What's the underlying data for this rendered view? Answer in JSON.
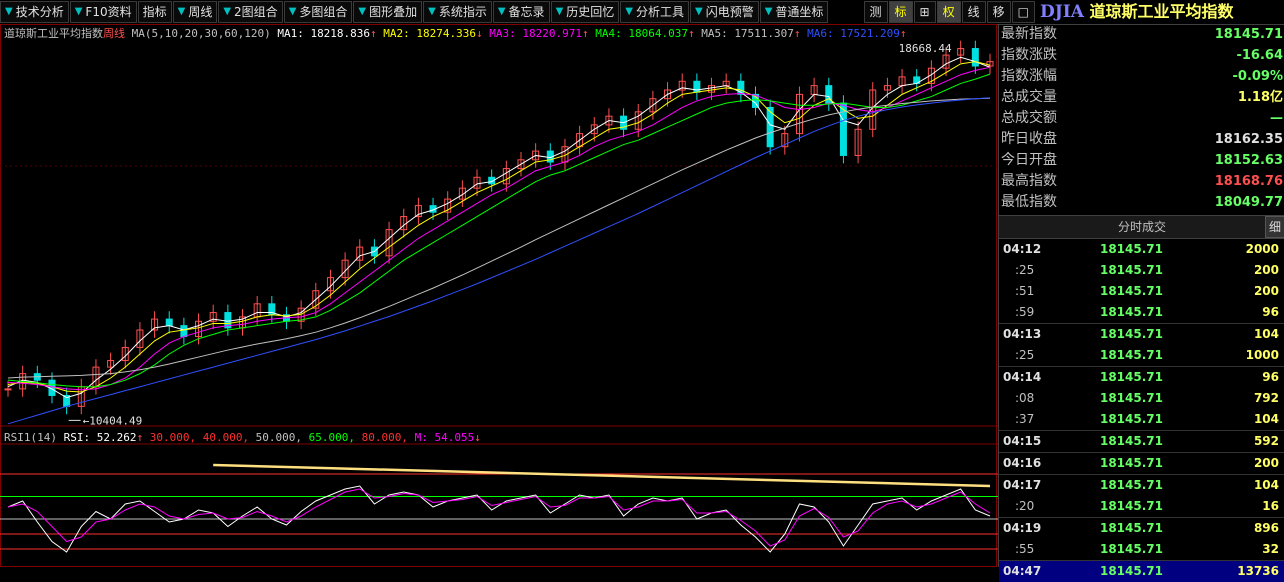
{
  "toolbar": {
    "items": [
      {
        "label": "技术分析",
        "arrow": true
      },
      {
        "label": "F10资料",
        "arrow": true
      },
      {
        "label": "指标",
        "arrow": false
      },
      {
        "label": "周线",
        "arrow": true
      },
      {
        "label": "2图组合",
        "arrow": true
      },
      {
        "label": "多图组合",
        "arrow": true
      },
      {
        "label": "图形叠加",
        "arrow": true
      },
      {
        "label": "系统指示",
        "arrow": true
      },
      {
        "label": "备忘录",
        "arrow": true
      },
      {
        "label": "历史回忆",
        "arrow": true
      },
      {
        "label": "分析工具",
        "arrow": true
      },
      {
        "label": "闪电预警",
        "arrow": true
      },
      {
        "label": "普通坐标",
        "arrow": true
      }
    ],
    "small": [
      "测",
      "标",
      "⊞",
      "权",
      "线",
      "移",
      "□"
    ]
  },
  "header": {
    "symbol": "DJIA",
    "name": "道琼斯工业平均指数"
  },
  "ma_legend": {
    "title": "道琼斯工业平均指数",
    "period": "周线",
    "params": "MA(5,10,20,30,60,120)",
    "items": [
      {
        "label": "MA1: 18218.836",
        "arrow": "↑",
        "color": "#ffffff"
      },
      {
        "label": "MA2: 18274.336",
        "arrow": "↓",
        "color": "#ffff00"
      },
      {
        "label": "MA3: 18220.971",
        "arrow": "↑",
        "color": "#ff00ff"
      },
      {
        "label": "MA4: 18064.037",
        "arrow": "↑",
        "color": "#00ff00"
      },
      {
        "label": "MA5: 17511.307",
        "arrow": "↑",
        "color": "#c0c0c0"
      },
      {
        "label": "MA6: 17521.209",
        "arrow": "↑",
        "color": "#3050ff"
      }
    ]
  },
  "rsi_legend": {
    "title": "RSI1(14)",
    "items": [
      {
        "label": "RSI: 52.262",
        "arrow": "↑",
        "color": "#ffffff"
      },
      {
        "label": "30.000,",
        "arrow": "",
        "color": "#ff3030"
      },
      {
        "label": "40.000,",
        "arrow": "",
        "color": "#ff3030"
      },
      {
        "label": "50.000,",
        "arrow": "",
        "color": "#c0c0c0"
      },
      {
        "label": "65.000,",
        "arrow": "",
        "color": "#00ff00"
      },
      {
        "label": "80.000,",
        "arrow": "",
        "color": "#ff3030"
      },
      {
        "label": "M: 54.055",
        "arrow": "↓",
        "color": "#ff00ff"
      }
    ]
  },
  "chart_data": {
    "type": "line",
    "title": "道琼斯工业平均指数 周线",
    "high_label": "18668.44",
    "low_label": "10404.49",
    "price_ylim": [
      10000,
      18800
    ],
    "rsi_ylim": [
      20,
      100
    ],
    "rsi_levels": [
      30,
      40,
      50,
      65,
      80
    ],
    "price_series": [
      {
        "name": "Close",
        "values": [
          10850,
          11200,
          11050,
          10700,
          10450,
          10900,
          11350,
          11500,
          11800,
          12200,
          12450,
          12300,
          12050,
          12400,
          12600,
          12250,
          12500,
          12800,
          12550,
          12400,
          12700,
          13100,
          13400,
          13800,
          14100,
          13900,
          14500,
          14800,
          15050,
          14900,
          15200,
          15450,
          15700,
          15550,
          15900,
          16100,
          16300,
          16050,
          16400,
          16700,
          16900,
          17100,
          16800,
          17200,
          17500,
          17700,
          17900,
          17650,
          17800,
          17900,
          17600,
          17300,
          16400,
          16700,
          17600,
          17800,
          17400,
          16200,
          16800,
          17700,
          17800,
          18000,
          17850,
          18200,
          18500,
          18650,
          18250,
          18350
        ]
      },
      {
        "name": "MA1",
        "values": [
          10900,
          11050,
          11000,
          10850,
          10650,
          10750,
          11050,
          11300,
          11600,
          11950,
          12250,
          12300,
          12200,
          12300,
          12450,
          12400,
          12450,
          12600,
          12600,
          12500,
          12600,
          12900,
          13200,
          13550,
          13900,
          14000,
          14300,
          14600,
          14850,
          14950,
          15100,
          15300,
          15550,
          15600,
          15800,
          16000,
          16200,
          16150,
          16300,
          16550,
          16800,
          17000,
          16950,
          17100,
          17350,
          17600,
          17750,
          17700,
          17750,
          17800,
          17650,
          17400,
          16900,
          16800,
          17250,
          17600,
          17550,
          17000,
          16900,
          17300,
          17600,
          17800,
          17850,
          18050,
          18300,
          18450,
          18350,
          18220
        ]
      },
      {
        "name": "MA2",
        "values": [
          10950,
          11000,
          10980,
          10900,
          10800,
          10780,
          10900,
          11100,
          11350,
          11650,
          11950,
          12150,
          12200,
          12250,
          12350,
          12350,
          12400,
          12500,
          12550,
          12520,
          12560,
          12750,
          13000,
          13300,
          13600,
          13850,
          14100,
          14350,
          14600,
          14800,
          14950,
          15150,
          15350,
          15500,
          15650,
          15850,
          16050,
          16100,
          16200,
          16400,
          16600,
          16800,
          16850,
          16950,
          17150,
          17400,
          17600,
          17650,
          17700,
          17750,
          17700,
          17550,
          17200,
          16950,
          17050,
          17350,
          17500,
          17250,
          17050,
          17100,
          17350,
          17600,
          17750,
          17900,
          18100,
          18300,
          18350,
          18270
        ]
      },
      {
        "name": "MA3",
        "values": [
          11000,
          10980,
          10950,
          10900,
          10850,
          10830,
          10850,
          10950,
          11100,
          11350,
          11650,
          11900,
          12050,
          12150,
          12250,
          12300,
          12330,
          12400,
          12450,
          12480,
          12500,
          12600,
          12800,
          13050,
          13300,
          13550,
          13800,
          14050,
          14300,
          14500,
          14700,
          14900,
          15100,
          15300,
          15450,
          15650,
          15850,
          15950,
          16050,
          16200,
          16400,
          16550,
          16650,
          16750,
          16900,
          17100,
          17300,
          17450,
          17550,
          17600,
          17620,
          17580,
          17450,
          17300,
          17250,
          17300,
          17400,
          17350,
          17250,
          17200,
          17300,
          17450,
          17600,
          17750,
          17900,
          18050,
          18150,
          18220
        ]
      },
      {
        "name": "MA4",
        "values": [
          11050,
          11020,
          10990,
          10950,
          10920,
          10900,
          10900,
          10950,
          11050,
          11200,
          11400,
          11650,
          11850,
          12000,
          12100,
          12200,
          12250,
          12300,
          12350,
          12400,
          12430,
          12500,
          12650,
          12850,
          13050,
          13300,
          13550,
          13800,
          14000,
          14200,
          14400,
          14600,
          14800,
          15000,
          15200,
          15400,
          15600,
          15750,
          15850,
          16000,
          16150,
          16300,
          16450,
          16550,
          16700,
          16850,
          17000,
          17150,
          17300,
          17400,
          17450,
          17480,
          17450,
          17400,
          17350,
          17350,
          17380,
          17400,
          17350,
          17300,
          17300,
          17350,
          17450,
          17550,
          17700,
          17850,
          17950,
          18064
        ]
      },
      {
        "name": "MA5",
        "values": [
          11100,
          11120,
          11130,
          11140,
          11150,
          11160,
          11180,
          11200,
          11240,
          11290,
          11350,
          11420,
          11500,
          11580,
          11660,
          11740,
          11810,
          11880,
          11940,
          12000,
          12070,
          12150,
          12250,
          12360,
          12480,
          12610,
          12740,
          12880,
          13020,
          13160,
          13310,
          13460,
          13620,
          13780,
          13940,
          14100,
          14270,
          14430,
          14590,
          14750,
          14910,
          15070,
          15230,
          15390,
          15550,
          15710,
          15870,
          16020,
          16170,
          16320,
          16460,
          16600,
          16720,
          16830,
          16940,
          17040,
          17130,
          17200,
          17260,
          17310,
          17350,
          17390,
          17420,
          17450,
          17470,
          17490,
          17500,
          17511
        ]
      },
      {
        "name": "MA6",
        "values": [
          10050,
          10150,
          10250,
          10350,
          10450,
          10540,
          10630,
          10720,
          10810,
          10900,
          10990,
          11080,
          11170,
          11260,
          11350,
          11440,
          11530,
          11620,
          11710,
          11800,
          11890,
          11980,
          12080,
          12180,
          12290,
          12400,
          12510,
          12630,
          12750,
          12870,
          13000,
          13130,
          13260,
          13400,
          13540,
          13680,
          13820,
          13970,
          14120,
          14270,
          14420,
          14570,
          14720,
          14870,
          15030,
          15190,
          15350,
          15510,
          15670,
          15830,
          15990,
          16150,
          16300,
          16450,
          16600,
          16750,
          16880,
          17000,
          17100,
          17180,
          17250,
          17310,
          17360,
          17400,
          17440,
          17470,
          17500,
          17521
        ]
      }
    ],
    "rsi_series": [
      {
        "name": "RSI",
        "values": [
          58,
          62,
          48,
          35,
          28,
          45,
          55,
          50,
          60,
          62,
          55,
          48,
          50,
          56,
          54,
          45,
          52,
          58,
          50,
          46,
          55,
          62,
          66,
          70,
          72,
          60,
          66,
          68,
          66,
          58,
          62,
          64,
          66,
          56,
          62,
          64,
          66,
          54,
          60,
          66,
          64,
          66,
          52,
          60,
          64,
          62,
          64,
          50,
          54,
          56,
          46,
          38,
          28,
          40,
          60,
          58,
          48,
          32,
          46,
          60,
          62,
          64,
          56,
          62,
          66,
          70,
          56,
          52
        ]
      },
      {
        "name": "M",
        "values": [
          58,
          60,
          55,
          45,
          35,
          38,
          48,
          50,
          56,
          60,
          58,
          52,
          50,
          53,
          54,
          50,
          51,
          55,
          52,
          48,
          52,
          58,
          63,
          68,
          70,
          64,
          65,
          67,
          66,
          61,
          62,
          63,
          65,
          59,
          61,
          63,
          65,
          58,
          59,
          64,
          64,
          65,
          56,
          58,
          62,
          62,
          63,
          54,
          54,
          55,
          49,
          42,
          32,
          36,
          52,
          57,
          51,
          38,
          42,
          54,
          60,
          62,
          58,
          60,
          64,
          68,
          60,
          54
        ]
      }
    ],
    "trendline": {
      "from": [
        14,
        86
      ],
      "to": [
        67,
        72
      ]
    }
  },
  "quote": {
    "rows": [
      {
        "label": "最新指数",
        "value": "18145.71",
        "color": "#66ff66"
      },
      {
        "label": "指数涨跌",
        "value": "-16.64",
        "color": "#66ff66"
      },
      {
        "label": "指数涨幅",
        "value": "-0.09%",
        "color": "#66ff66"
      },
      {
        "label": "总成交量",
        "value": "1.18亿",
        "color": "#ffff66"
      },
      {
        "label": "总成交额",
        "value": "—",
        "color": "#66ff66"
      },
      {
        "label": "昨日收盘",
        "value": "18162.35",
        "color": "#e0e0e0"
      },
      {
        "label": "今日开盘",
        "value": "18152.63",
        "color": "#66ff66"
      },
      {
        "label": "最高指数",
        "value": "18168.76",
        "color": "#ff5050"
      },
      {
        "label": "最低指数",
        "value": "18049.77",
        "color": "#66ff66"
      }
    ]
  },
  "ticks": {
    "header": "分时成交",
    "header_btn": "细",
    "rows": [
      {
        "time": "04:12",
        "price": "18145.71",
        "vol": "2000",
        "main": true
      },
      {
        "time": ":25",
        "price": "18145.71",
        "vol": "200",
        "main": false
      },
      {
        "time": ":51",
        "price": "18145.71",
        "vol": "200",
        "main": false
      },
      {
        "time": ":59",
        "price": "18145.71",
        "vol": "96",
        "main": false
      },
      {
        "time": "04:13",
        "price": "18145.71",
        "vol": "104",
        "main": true
      },
      {
        "time": ":25",
        "price": "18145.71",
        "vol": "1000",
        "main": false
      },
      {
        "time": "04:14",
        "price": "18145.71",
        "vol": "96",
        "main": true
      },
      {
        "time": ":08",
        "price": "18145.71",
        "vol": "792",
        "main": false
      },
      {
        "time": ":37",
        "price": "18145.71",
        "vol": "104",
        "main": false
      },
      {
        "time": "04:15",
        "price": "18145.71",
        "vol": "592",
        "main": true
      },
      {
        "time": "04:16",
        "price": "18145.71",
        "vol": "200",
        "main": true
      },
      {
        "time": "04:17",
        "price": "18145.71",
        "vol": "104",
        "main": true
      },
      {
        "time": ":20",
        "price": "18145.71",
        "vol": "16",
        "main": false
      },
      {
        "time": "04:19",
        "price": "18145.71",
        "vol": "896",
        "main": true
      },
      {
        "time": ":55",
        "price": "18145.71",
        "vol": "32",
        "main": false
      },
      {
        "time": "04:47",
        "price": "18145.71",
        "vol": "13736",
        "main": true
      }
    ]
  }
}
